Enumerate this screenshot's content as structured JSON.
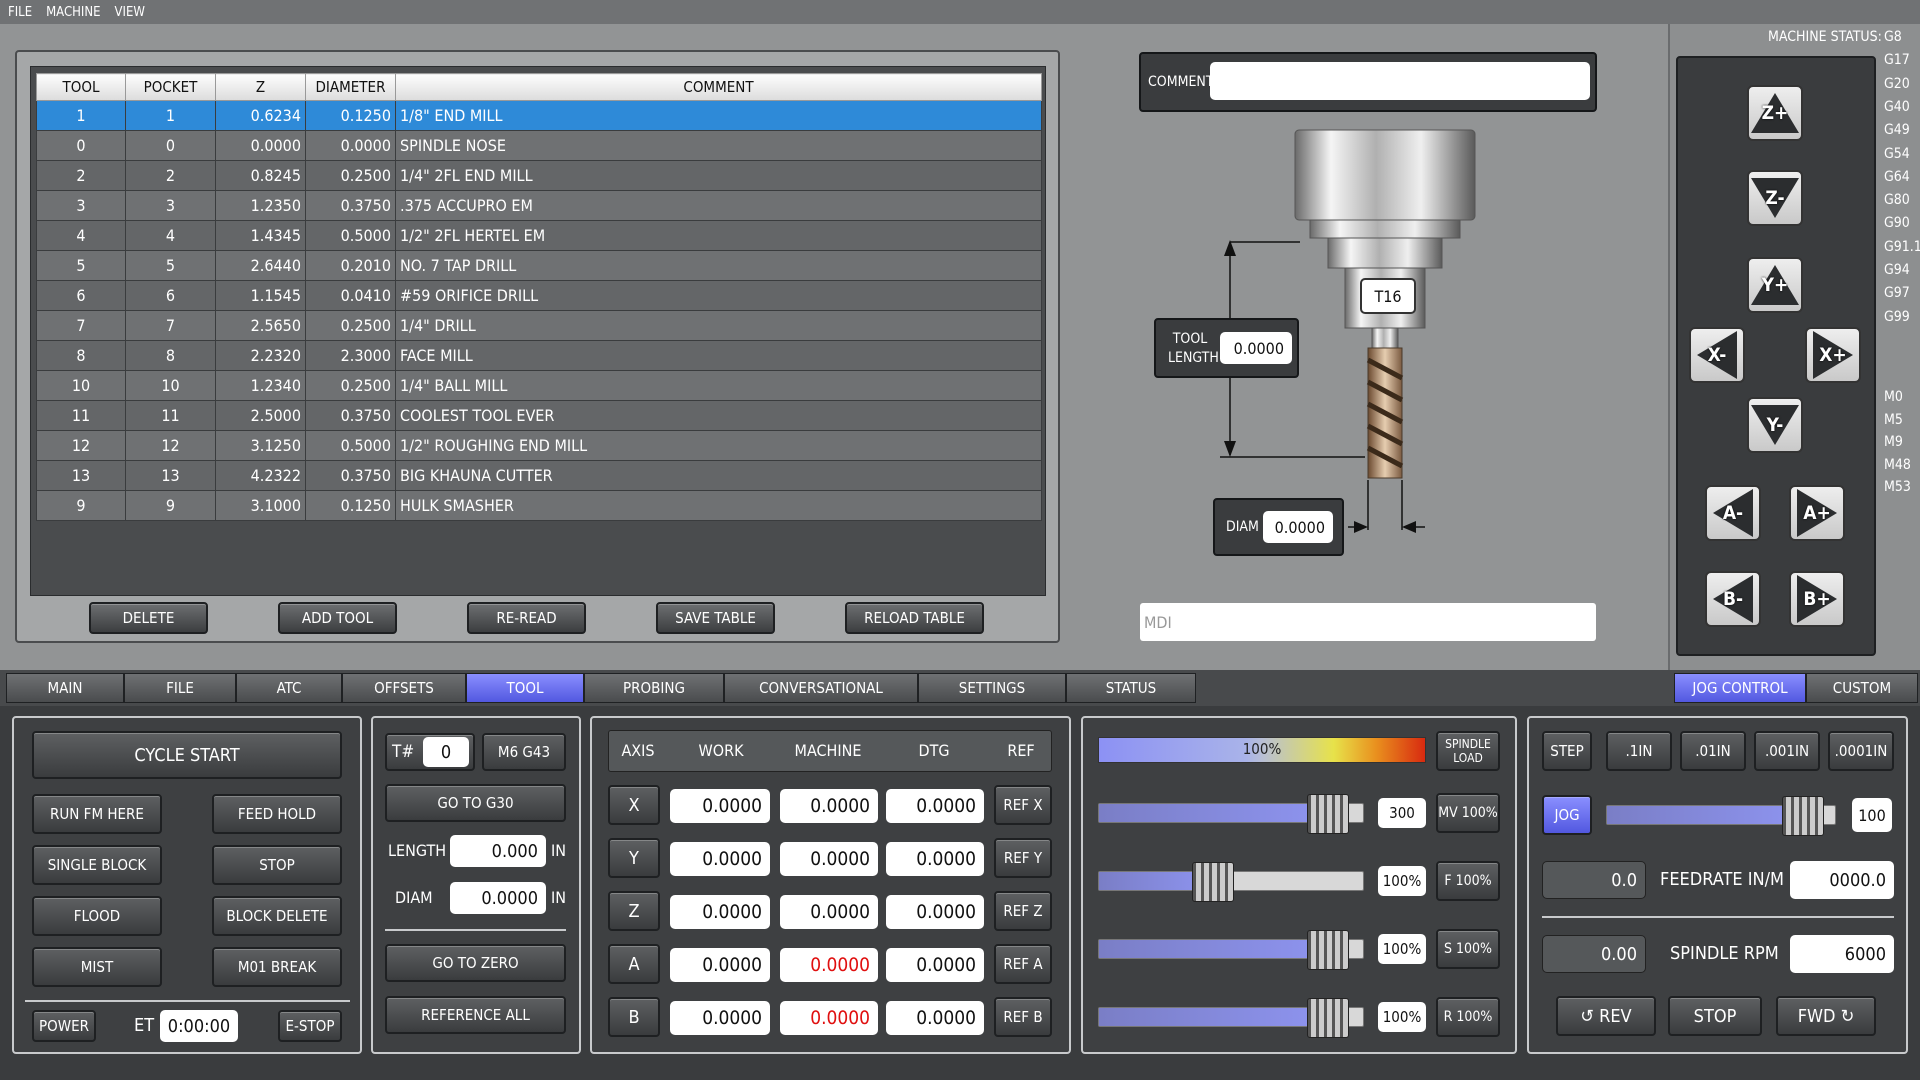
{
  "menu": {
    "file": "FILE",
    "machine": "MACHINE",
    "view": "VIEW"
  },
  "tool_table": {
    "headers": [
      "TOOL",
      "POCKET",
      "Z",
      "DIAMETER",
      "COMMENT"
    ],
    "rows": [
      [
        "1",
        "1",
        "0.6234",
        "0.1250",
        "1/8\" END MILL"
      ],
      [
        "0",
        "0",
        "0.0000",
        "0.0000",
        "SPINDLE NOSE"
      ],
      [
        "2",
        "2",
        "0.8245",
        "0.2500",
        "1/4\" 2FL END MILL"
      ],
      [
        "3",
        "3",
        "1.2350",
        "0.3750",
        ".375 ACCUPRO EM"
      ],
      [
        "4",
        "4",
        "1.4345",
        "0.5000",
        "1/2\" 2FL HERTEL EM"
      ],
      [
        "5",
        "5",
        "2.6440",
        "0.2010",
        "NO. 7 TAP DRILL"
      ],
      [
        "6",
        "6",
        "1.1545",
        "0.0410",
        "#59 ORIFICE DRILL"
      ],
      [
        "7",
        "7",
        "2.5650",
        "0.2500",
        "1/4\" DRILL"
      ],
      [
        "8",
        "8",
        "2.2320",
        "2.3000",
        "FACE MILL"
      ],
      [
        "10",
        "10",
        "1.2340",
        "0.2500",
        "1/4\" BALL MILL"
      ],
      [
        "11",
        "11",
        "2.5000",
        "0.3750",
        "COOLEST TOOL EVER"
      ],
      [
        "12",
        "12",
        "3.1250",
        "0.5000",
        "1/2\" ROUGHING END MILL"
      ],
      [
        "13",
        "13",
        "4.2322",
        "0.3750",
        "BIG KHAUNA CUTTER"
      ],
      [
        "9",
        "9",
        "3.1000",
        "0.1250",
        "HULK SMASHER"
      ]
    ],
    "buttons": {
      "delete": "DELETE",
      "add": "ADD TOOL",
      "reread": "RE-READ",
      "save": "SAVE TABLE",
      "reload": "RELOAD TABLE"
    }
  },
  "tool_view": {
    "comment_label": "COMMENT",
    "comment_value": "",
    "tool_tag": "T16",
    "length_label_1": "TOOL",
    "length_label_2": "LENGTH",
    "length_value": "0.0000",
    "diam_label": "DIAM",
    "diam_value": "0.0000",
    "mdi_placeholder": "MDI"
  },
  "machine_status": {
    "label": "MACHINE STATUS:",
    "gcodes": [
      "G8",
      "G17",
      "G20",
      "G40",
      "G49",
      "G54",
      "G64",
      "G80",
      "G90",
      "G91.1",
      "G94",
      "G97",
      "G99"
    ],
    "mcodes": [
      "M0",
      "M5",
      "M9",
      "M48",
      "M53"
    ]
  },
  "jog_buttons": {
    "zplus": "Z+",
    "zminus": "Z-",
    "yplus": "Y+",
    "yminus": "Y-",
    "xminus": "X-",
    "xplus": "X+",
    "aminus": "A-",
    "aplus": "A+",
    "bminus": "B-",
    "bplus": "B+"
  },
  "tabs": [
    "MAIN",
    "FILE",
    "ATC",
    "OFFSETS",
    "TOOL",
    "PROBING",
    "CONVERSATIONAL",
    "SETTINGS",
    "STATUS"
  ],
  "right_tabs": [
    "JOG CONTROL",
    "CUSTOM"
  ],
  "cycle": {
    "cycle_start": "CYCLE START",
    "run_fm_here": "RUN FM HERE",
    "feed_hold": "FEED HOLD",
    "single_block": "SINGLE BLOCK",
    "stop": "STOP",
    "flood": "FLOOD",
    "block_delete": "BLOCK DELETE",
    "mist": "MIST",
    "m01_break": "M01 BREAK",
    "power": "POWER",
    "et_label": "ET",
    "et_value": "0:00:00",
    "estop": "E-STOP"
  },
  "tool_ctrl": {
    "t_label": "T#",
    "t_value": "0",
    "m6": "M6 G43",
    "g30": "GO TO G30",
    "length_label": "LENGTH",
    "length_value": "0.000",
    "length_unit": "IN",
    "diam_label": "DIAM",
    "diam_value": "0.0000",
    "diam_unit": "IN",
    "go_zero": "GO TO ZERO",
    "ref_all": "REFERENCE ALL"
  },
  "dro": {
    "headers": [
      "AXIS",
      "WORK",
      "MACHINE",
      "DTG",
      "REF"
    ],
    "rows": [
      {
        "axis": "X",
        "work": "0.0000",
        "machine": "0.0000",
        "dtg": "0.0000",
        "ref": "REF X"
      },
      {
        "axis": "Y",
        "work": "0.0000",
        "machine": "0.0000",
        "dtg": "0.0000",
        "ref": "REF Y"
      },
      {
        "axis": "Z",
        "work": "0.0000",
        "machine": "0.0000",
        "dtg": "0.0000",
        "ref": "REF Z"
      },
      {
        "axis": "A",
        "work": "0.0000",
        "machine": "0.0000",
        "dtg": "0.0000",
        "ref": "REF A"
      },
      {
        "axis": "B",
        "work": "0.0000",
        "machine": "0.0000",
        "dtg": "0.0000",
        "ref": "REF B"
      }
    ]
  },
  "overrides": {
    "spindle_load_value": "100%",
    "spindle_load_label_1": "SPINDLE",
    "spindle_load_label_2": "LOAD",
    "spindle_load_fraction": 1.0,
    "sliders": [
      {
        "value": "300",
        "button": "MV 100%",
        "fraction": 0.86
      },
      {
        "value": "100%",
        "button": "F 100%",
        "fraction": 0.43
      },
      {
        "value": "100%",
        "button": "S 100%",
        "fraction": 0.86
      },
      {
        "value": "100%",
        "button": "R 100%",
        "fraction": 0.86
      }
    ]
  },
  "jog": {
    "step": "STEP",
    "inc": [
      ".1IN",
      ".01IN",
      ".001IN",
      ".0001IN"
    ],
    "jog": "JOG",
    "jog_value": "100",
    "jog_fraction": 0.85,
    "feed_actual": "0.0",
    "feed_label": "FEEDRATE IN/M",
    "feed_set": "0000.0",
    "rpm_actual": "0.00",
    "rpm_label": "SPINDLE RPM",
    "rpm_set": "6000",
    "rev": "REV",
    "stop": "STOP",
    "fwd": "FWD"
  },
  "colors": {
    "selected_row": "#2e8ad8",
    "active_tab": "#5c62f0",
    "machine_red": "#e01010"
  }
}
